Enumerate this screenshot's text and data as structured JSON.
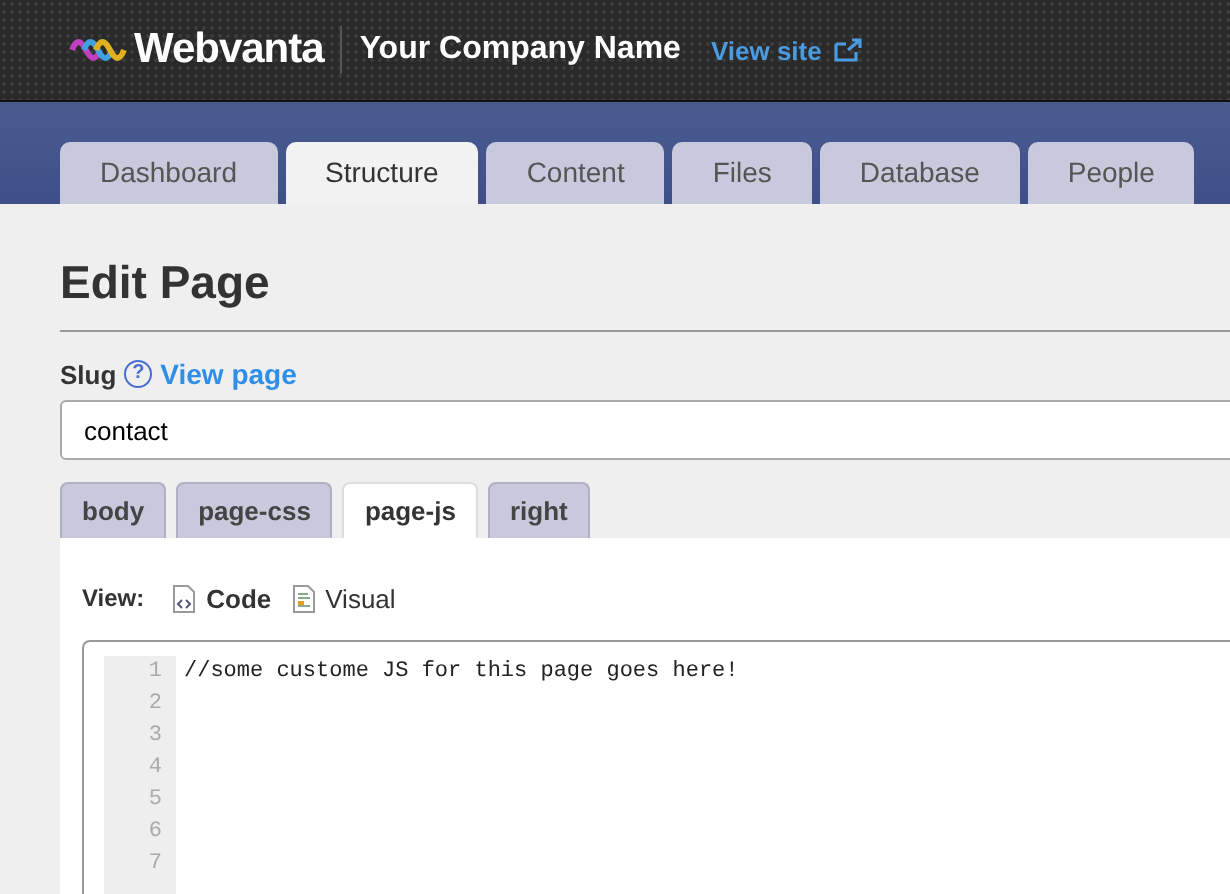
{
  "header": {
    "brand": "Webvanta",
    "company": "Your Company Name",
    "view_site": "View site"
  },
  "tabs": [
    {
      "label": "Dashboard",
      "selected": false
    },
    {
      "label": "Structure",
      "selected": true
    },
    {
      "label": "Content",
      "selected": false
    },
    {
      "label": "Files",
      "selected": false
    },
    {
      "label": "Database",
      "selected": false
    },
    {
      "label": "People",
      "selected": false
    }
  ],
  "page_title": "Edit Page",
  "slug": {
    "label": "Slug",
    "help": "?",
    "link": "View page",
    "value": "contact"
  },
  "editor_tabs": [
    {
      "label": "body",
      "selected": false
    },
    {
      "label": "page-css",
      "selected": false
    },
    {
      "label": "page-js",
      "selected": true
    },
    {
      "label": "right",
      "selected": false
    }
  ],
  "view": {
    "label": "View:",
    "modes": [
      {
        "label": "Code",
        "kind": "code",
        "selected": true
      },
      {
        "label": "Visual",
        "kind": "visual",
        "selected": false
      }
    ]
  },
  "code_lines": [
    {
      "number": "1",
      "text": "//some custome JS for this page goes here!"
    },
    {
      "number": "2"
    },
    {
      "number": "3"
    },
    {
      "number": "4"
    },
    {
      "number": "5"
    },
    {
      "number": "6"
    },
    {
      "number": "7"
    }
  ]
}
